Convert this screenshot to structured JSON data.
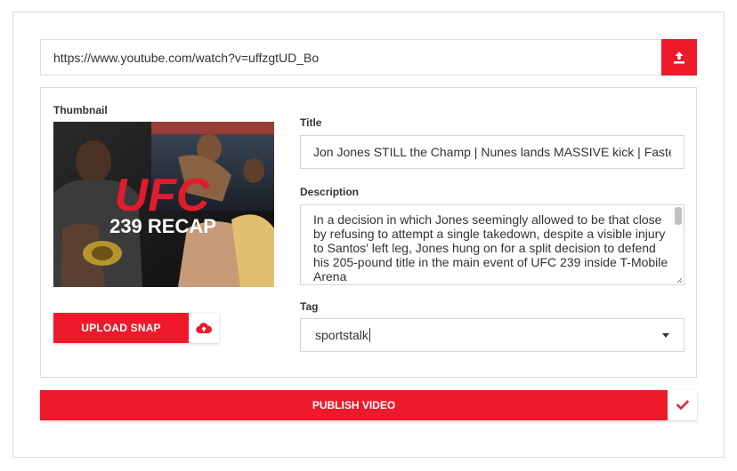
{
  "url_input": {
    "value": "https://www.youtube.com/watch?v=uffzgtUD_Bo",
    "submit_icon": "upload-icon"
  },
  "thumbnail": {
    "label": "Thumbnail",
    "brand_text": "UFC",
    "recap_text": "239 RECAP"
  },
  "upload_snap": {
    "label": "UPLOAD SNAP",
    "icon": "cloud-upload-icon"
  },
  "title": {
    "label": "Title",
    "value": "Jon Jones STILL the Champ | Nunes lands MASSIVE kick | Fastes"
  },
  "description": {
    "label": "Description",
    "value": "In a decision in which Jones seemingly allowed to be that close by refusing to attempt a single takedown, despite a visible injury to Santos' left leg, Jones hung on for a split decision to defend his 205-pound title in the main event of UFC 239 inside T-Mobile Arena"
  },
  "tag": {
    "label": "Tag",
    "value": "sportstalk"
  },
  "publish": {
    "label": "PUBLISH VIDEO",
    "icon": "check-icon"
  },
  "colors": {
    "accent": "#ee1a2b",
    "border": "#dcdcdc"
  }
}
